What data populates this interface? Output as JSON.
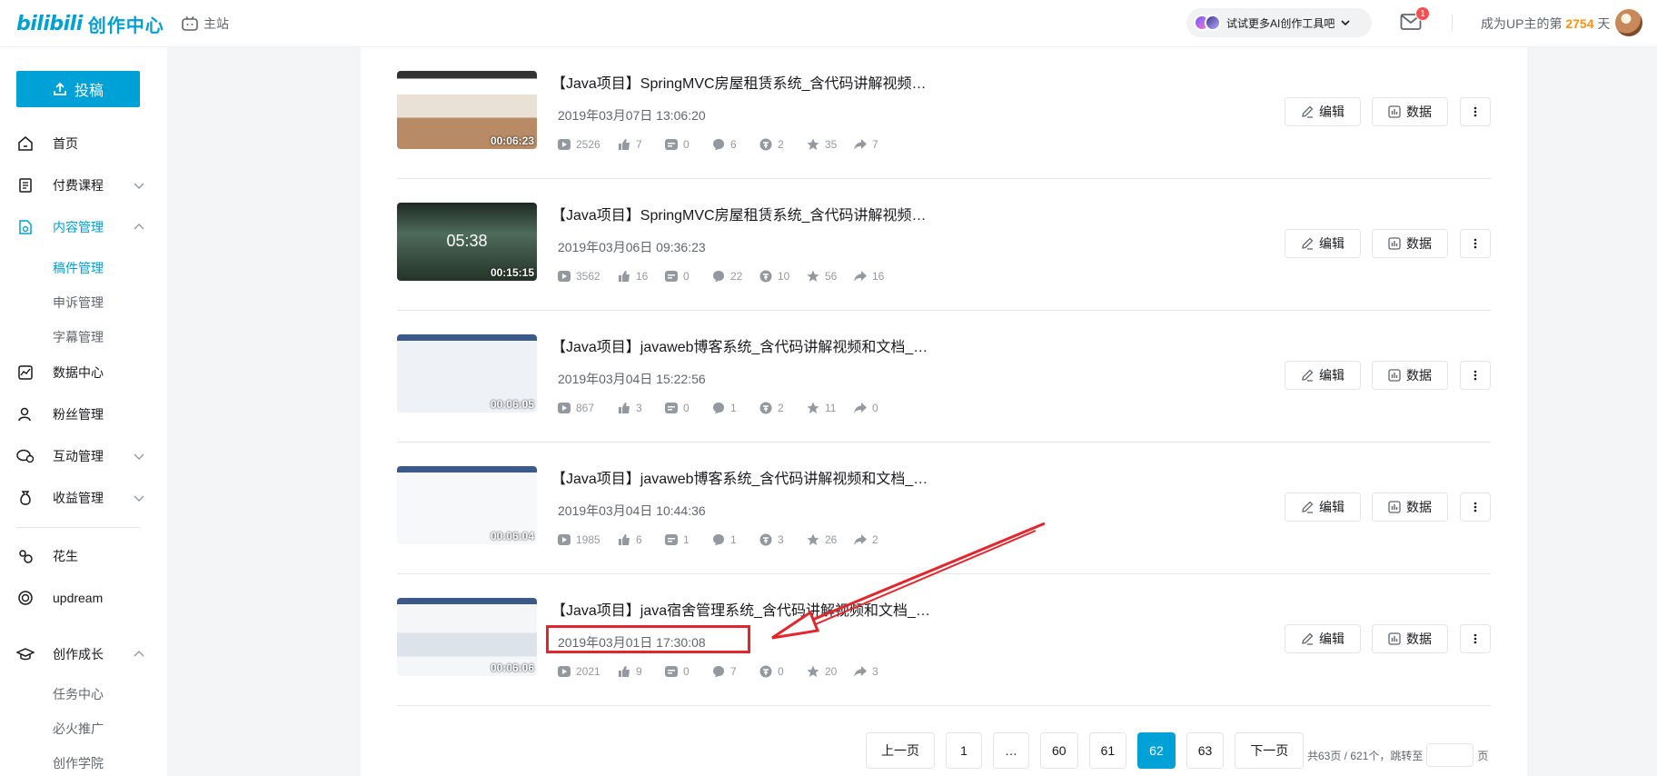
{
  "header": {
    "brand": "bilibili",
    "title": "创作中心",
    "home_label": "主站",
    "ai_label": "试试更多AI创作工具吧",
    "mail_badge": "1",
    "up_prefix": "成为UP主的第",
    "up_days": "2754",
    "up_suffix": "天"
  },
  "sidebar": {
    "upload_label": "投稿",
    "items": [
      {
        "label": "首页",
        "icon": "home-icon"
      },
      {
        "label": "付费课程",
        "icon": "course-icon"
      },
      {
        "label": "内容管理",
        "icon": "content-icon"
      },
      {
        "label": "数据中心",
        "icon": "chart-icon"
      },
      {
        "label": "粉丝管理",
        "icon": "fans-icon"
      },
      {
        "label": "互动管理",
        "icon": "interact-icon"
      },
      {
        "label": "收益管理",
        "icon": "income-icon"
      },
      {
        "label": "花生",
        "icon": "peanut-icon"
      },
      {
        "label": "updream",
        "icon": "updream-icon"
      },
      {
        "label": "创作成长",
        "icon": "growth-icon"
      }
    ],
    "content_sub": [
      "稿件管理",
      "申诉管理",
      "字幕管理"
    ],
    "growth_sub": [
      "任务中心",
      "必火推广",
      "创作学院"
    ]
  },
  "items": [
    {
      "title": "【Java项目】SpringMVC房屋租赁系统_含代码讲解视频…",
      "date": "2019年03月07日 13:06:20",
      "duration": "00:06:23",
      "stats": [
        "2526",
        "7",
        "0",
        "6",
        "2",
        "35",
        "7"
      ]
    },
    {
      "title": "【Java项目】SpringMVC房屋租赁系统_含代码讲解视频…",
      "date": "2019年03月06日 09:36:23",
      "duration": "00:15:15",
      "thumb_time": "05:38",
      "stats": [
        "3562",
        "16",
        "0",
        "22",
        "10",
        "56",
        "16"
      ]
    },
    {
      "title": "【Java项目】javaweb博客系统_含代码讲解视频和文档_…",
      "date": "2019年03月04日 15:22:56",
      "duration": "00:06:05",
      "stats": [
        "867",
        "3",
        "0",
        "1",
        "2",
        "11",
        "0"
      ]
    },
    {
      "title": "【Java项目】javaweb博客系统_含代码讲解视频和文档_…",
      "date": "2019年03月04日 10:44:36",
      "duration": "00:06:04",
      "stats": [
        "1985",
        "6",
        "1",
        "1",
        "3",
        "26",
        "2"
      ]
    },
    {
      "title": "【Java项目】java宿舍管理系统_含代码讲解视频和文档_…",
      "date": "2019年03月01日 17:30:08",
      "duration": "00:06:06",
      "stats": [
        "2021",
        "9",
        "0",
        "7",
        "0",
        "20",
        "3"
      ]
    }
  ],
  "actions": {
    "edit": "编辑",
    "data": "数据"
  },
  "pagination": {
    "prev": "上一页",
    "next": "下一页",
    "pages": [
      "1",
      "…",
      "60",
      "61",
      "62",
      "63"
    ],
    "current": "62",
    "summary": "共63页 / 621个，跳转至",
    "unit": "页"
  },
  "colors": {
    "accent": "#00a1d6",
    "highlight": "#e3262c",
    "gold": "#ff9212"
  }
}
